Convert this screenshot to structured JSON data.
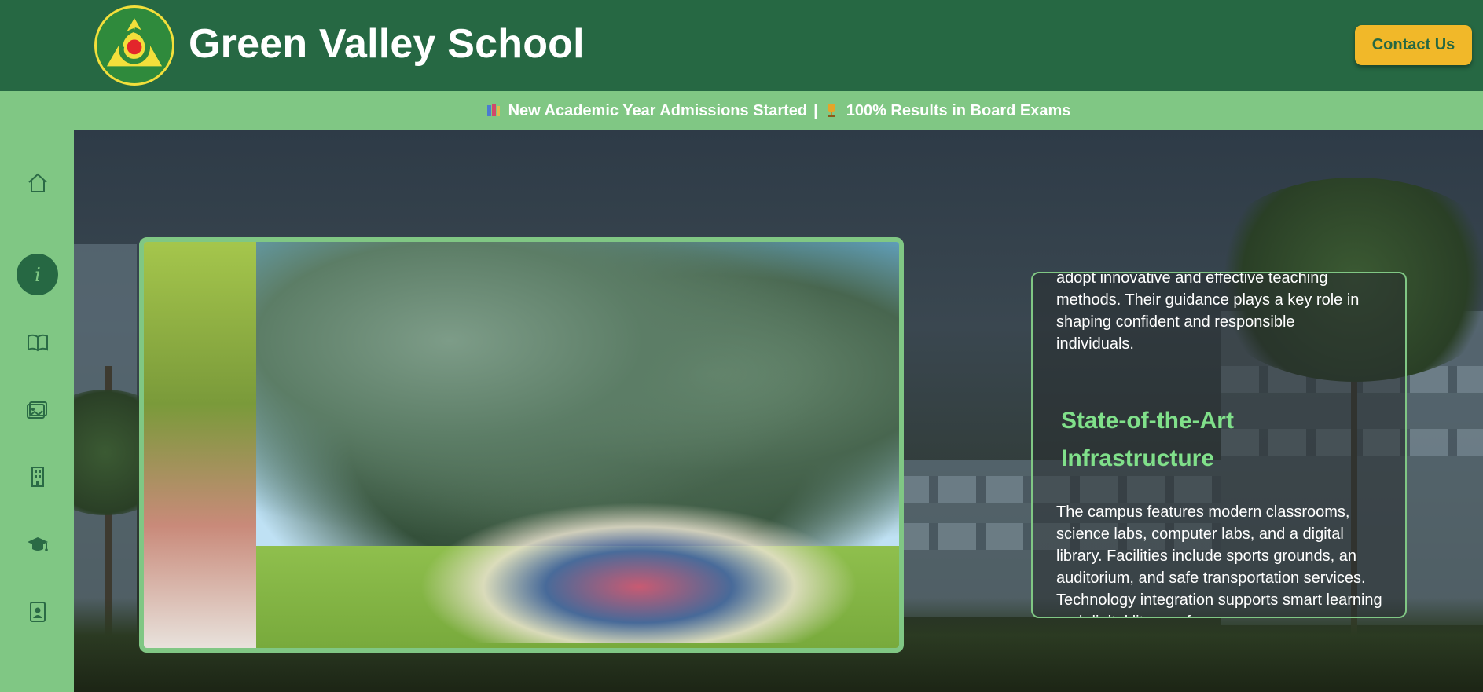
{
  "header": {
    "logo_alt": "school-logo",
    "title": "Green Valley School",
    "contact_label": "Contact Us"
  },
  "ticker": {
    "item1": "New Academic Year Admissions Started",
    "separator": "|",
    "item2": "100% Results in Board Exams"
  },
  "sidebar": {
    "items": [
      {
        "icon": "home-icon"
      },
      {
        "icon": "info-icon",
        "active": true
      },
      {
        "icon": "book-icon"
      },
      {
        "icon": "gallery-icon"
      },
      {
        "icon": "building-icon"
      },
      {
        "icon": "graduation-cap-icon"
      },
      {
        "icon": "contact-card-icon"
      }
    ]
  },
  "info_card": {
    "intro_text": "adopt innovative and effective teaching methods. Their guidance plays a key role in shaping confident and responsible individuals.",
    "heading": "State-of-the-Art Infrastructure",
    "body_text": "The campus features modern classrooms, science labs, computer labs, and a digital library. Facilities include sports grounds, an auditorium, and safe transportation services. Technology integration supports smart learning and digital literacy for"
  },
  "colors": {
    "brand_green": "#266843",
    "light_green": "#80c784",
    "accent_yellow": "#f1b829"
  }
}
